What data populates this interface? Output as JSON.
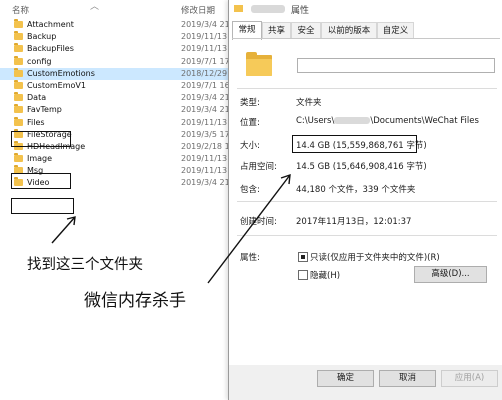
{
  "explorer": {
    "col_name": "名称",
    "col_date": "修改日期",
    "files": [
      {
        "name": "Attachment",
        "date": "2019/3/4 21"
      },
      {
        "name": "Backup",
        "date": "2019/11/13"
      },
      {
        "name": "BackupFiles",
        "date": "2019/11/13"
      },
      {
        "name": "config",
        "date": "2019/7/1 17"
      },
      {
        "name": "CustomEmotions",
        "date": "2018/12/29"
      },
      {
        "name": "CustomEmoV1",
        "date": "2019/7/1 16"
      },
      {
        "name": "Data",
        "date": "2019/3/4 21"
      },
      {
        "name": "FavTemp",
        "date": "2019/3/4 21"
      },
      {
        "name": "Files",
        "date": "2019/11/13"
      },
      {
        "name": "FileStorage",
        "date": "2019/3/5 17"
      },
      {
        "name": "HDHeadImage",
        "date": "2019/2/18 1"
      },
      {
        "name": "Image",
        "date": "2019/11/13"
      },
      {
        "name": "Msg",
        "date": "2019/11/13"
      },
      {
        "name": "Video",
        "date": "2019/3/4 21"
      }
    ],
    "selected_folder": "CustomEmotions"
  },
  "annotations": {
    "find_folders": "找到这三个文件夹",
    "wechat_killer": "微信内存杀手"
  },
  "dialog": {
    "title": "属性",
    "tabs": [
      "常规",
      "共享",
      "安全",
      "以前的版本",
      "自定义"
    ],
    "active_tab": "常规",
    "type_label": "类型:",
    "type_value": "文件夹",
    "location_label": "位置:",
    "location_prefix": "C:\\Users\\",
    "location_suffix": "\\Documents\\WeChat Files",
    "size_label": "大小:",
    "size_value": "14.4 GB (15,559,868,761 字节)",
    "disk_label": "占用空间:",
    "disk_value": "14.5 GB (15,646,908,416 字节)",
    "contains_label": "包含:",
    "contains_value": "44,180 个文件，339 个文件夹",
    "created_label": "创建时间:",
    "created_value": "2017年11月13日，12:01:37",
    "attributes_label": "属性:",
    "readonly_label": "只读(仅应用于文件夹中的文件)(R)",
    "hidden_label": "隐藏(H)",
    "advanced_label": "高级(D)...",
    "ok_label": "确定",
    "cancel_label": "取消",
    "apply_label": "应用(A)"
  },
  "colors": {
    "folder": "#f3c24d",
    "selection": "#cce8ff",
    "button_face": "#e1e1e1"
  }
}
